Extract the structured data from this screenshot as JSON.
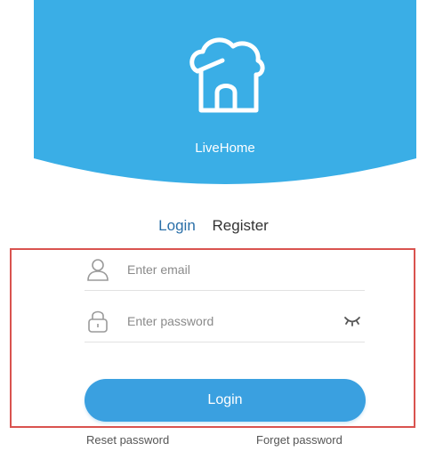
{
  "app": {
    "name": "LiveHome"
  },
  "colors": {
    "header_bg": "#3aaee6",
    "accent": "#3aa0e0",
    "highlight_border": "#d9534f"
  },
  "tabs": {
    "login": "Login",
    "register": "Register"
  },
  "form": {
    "email_placeholder": "Enter email",
    "password_placeholder": "Enter password",
    "submit_label": "Login"
  },
  "links": {
    "reset_password": "Reset password",
    "forget_password": "Forget password"
  },
  "icons": {
    "logo": "cloud-house-icon",
    "email": "user-icon",
    "password": "lock-icon",
    "toggle": "eye-closed-icon"
  }
}
